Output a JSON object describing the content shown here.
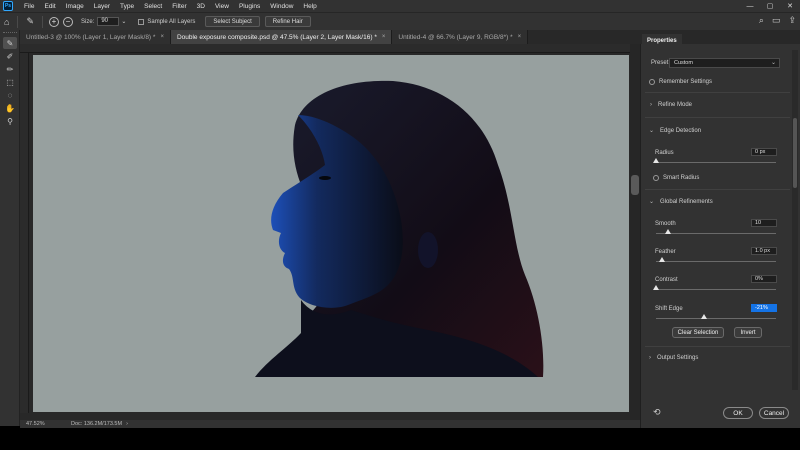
{
  "menu": {
    "items": [
      "File",
      "Edit",
      "Image",
      "Layer",
      "Type",
      "Select",
      "Filter",
      "3D",
      "View",
      "Plugins",
      "Window",
      "Help"
    ]
  },
  "logo": "Ps",
  "window_controls": {
    "minimize": "—",
    "maximize": "▢",
    "close": "✕"
  },
  "options": {
    "size_label": "Size:",
    "size_value": "90",
    "sample_all_layers": "Sample All Layers",
    "select_subject": "Select Subject",
    "refine_hair": "Refine Hair"
  },
  "tabs": [
    {
      "label": "Untitled-3 @ 100% (Layer 1, Layer Mask/8) *",
      "close": "×"
    },
    {
      "label": "Double exposure composite.psd @ 47.5% (Layer 2, Layer Mask/16) *",
      "close": "×"
    },
    {
      "label": "Untitled-4 @ 66.7% (Layer 9, RGB/8*) *",
      "close": "×"
    }
  ],
  "status": {
    "zoom": "47.52%",
    "doc": "Doc: 136.2M/173.5M",
    "arrow": "›"
  },
  "panel": {
    "tab": "Properties",
    "preset_label": "Preset:",
    "preset_value": "Custom",
    "remember_settings": "Remember Settings",
    "refine_mode": "Refine Mode",
    "edge_detection": "Edge Detection",
    "radius_label": "Radius",
    "radius_value": "0 px",
    "smart_radius": "Smart Radius",
    "global_refinements": "Global Refinements",
    "smooth_label": "Smooth",
    "smooth_value": "10",
    "feather_label": "Feather",
    "feather_value": "1.0 px",
    "contrast_label": "Contrast",
    "contrast_value": "0%",
    "shift_edge_label": "Shift Edge",
    "shift_edge_value": "-21%",
    "clear_selection": "Clear Selection",
    "invert": "Invert",
    "output_settings": "Output Settings",
    "ok": "OK",
    "cancel": "Cancel"
  },
  "sliders": {
    "radius": 0,
    "smooth": 0.1,
    "feather": 0.05,
    "contrast": 0,
    "shift_edge": 0.4
  },
  "colors": {
    "canvas_bg": "#97a09f",
    "accent": "#1473e6",
    "chrome": "#323232"
  }
}
